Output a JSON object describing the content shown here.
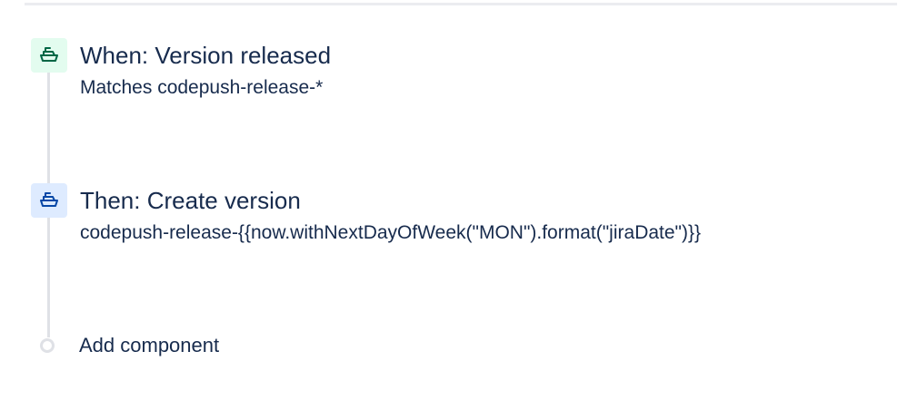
{
  "trigger": {
    "icon": "ship-icon",
    "title": "When: Version released",
    "detail": "Matches codepush-release-*"
  },
  "action": {
    "icon": "ship-icon",
    "title": "Then: Create version",
    "detail": "codepush-release-{{now.withNextDayOfWeek(\"MON\").format(\"jiraDate\")}}"
  },
  "add_component": {
    "label": "Add component"
  },
  "colors": {
    "trigger_bg": "#e3fcef",
    "trigger_icon": "#006644",
    "action_bg": "#deebff",
    "action_icon": "#0747a6",
    "text": "#172b4d",
    "rail": "#dfe1e6"
  }
}
